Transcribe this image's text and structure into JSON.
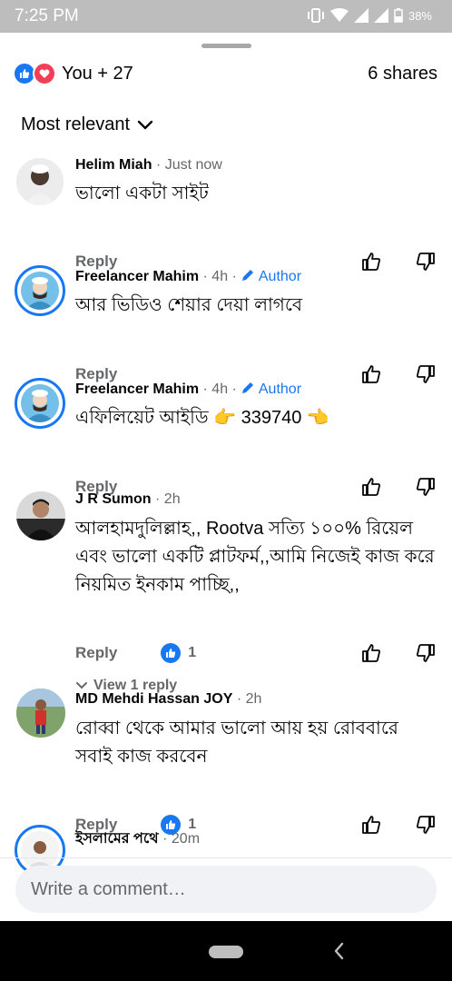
{
  "status_bar": {
    "time": "7:25 PM",
    "battery": "38%"
  },
  "reactions": {
    "count_label": "You + 27",
    "shares_label": "6 shares"
  },
  "sort": {
    "label": "Most relevant"
  },
  "comments": [
    {
      "name": "Helim Miah",
      "time": "· Just now",
      "author": "",
      "text": "ভালো একটা সাইট",
      "reply": "Reply",
      "likes": ""
    },
    {
      "name": "Freelancer Mahim",
      "time": "· 4h ·",
      "author": "Author",
      "text": "আর ভিডিও শেয়ার দেয়া লাগবে",
      "reply": "Reply",
      "likes": ""
    },
    {
      "name": "Freelancer Mahim",
      "time": "· 4h ·",
      "author": "Author",
      "text": "এফিলিয়েট আইডি 👉 339740 👈",
      "reply": "Reply",
      "likes": ""
    },
    {
      "name": "J R Sumon",
      "time": "· 2h",
      "author": "",
      "text": "আলহামদুলিল্লাহ,, Rootva সত্যি ১০০% রিয়েল এবং ভালো একটি প্লাটফর্ম,,আমি নিজেই কাজ করে নিয়মিত ইনকাম পাচ্ছি,,",
      "reply": "Reply",
      "likes": "1",
      "view_replies": "View 1 reply"
    },
    {
      "name": "MD Mehdi Hassan JOY",
      "time": "· 2h",
      "author": "",
      "text": "রোব্বা থেকে আমার ভালো আয় হয় রোববারে সবাই কাজ করবেন",
      "reply": "Reply",
      "likes": "1"
    },
    {
      "name": "ইসলামের পথে",
      "time": "· 20m",
      "author": "",
      "text": "",
      "reply": "",
      "likes": ""
    }
  ],
  "composer": {
    "placeholder": "Write a comment…"
  },
  "colors": {
    "accent": "#1877f2",
    "love": "#f33e58",
    "muted": "#65676b"
  }
}
